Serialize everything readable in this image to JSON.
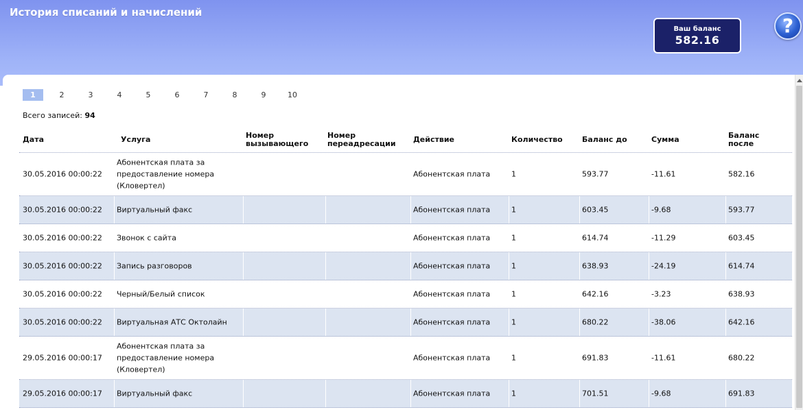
{
  "header": {
    "title": "История списаний и начислений",
    "balance_label": "Ваш баланс",
    "balance_value": "582.16",
    "help_icon": "?"
  },
  "pagination": {
    "pages": [
      "1",
      "2",
      "3",
      "4",
      "5",
      "6",
      "7",
      "8",
      "9",
      "10"
    ],
    "current": "1"
  },
  "summary": {
    "total_label": "Всего записей:",
    "total_count": "94"
  },
  "table": {
    "columns": {
      "date": "Дата",
      "service": "Услуга",
      "caller": "Номер вызывающего",
      "forward": "Номер переадресации",
      "action": "Действие",
      "qty": "Количество",
      "before": "Баланс до",
      "amount": "Сумма",
      "after": "Баланс после"
    },
    "rows": [
      {
        "date": "30.05.2016 00:00:22",
        "service": "Абонентская плата за предоставление номера (Кловертел)",
        "caller": "",
        "forward": "",
        "action": "Абонентская плата",
        "qty": "1",
        "before": "593.77",
        "amount": "-11.61",
        "after": "582.16"
      },
      {
        "date": "30.05.2016 00:00:22",
        "service": "Виртуальный факс",
        "caller": "",
        "forward": "",
        "action": "Абонентская плата",
        "qty": "1",
        "before": "603.45",
        "amount": "-9.68",
        "after": "593.77"
      },
      {
        "date": "30.05.2016 00:00:22",
        "service": "Звонок с сайта",
        "caller": "",
        "forward": "",
        "action": "Абонентская плата",
        "qty": "1",
        "before": "614.74",
        "amount": "-11.29",
        "after": "603.45"
      },
      {
        "date": "30.05.2016 00:00:22",
        "service": "Запись разговоров",
        "caller": "",
        "forward": "",
        "action": "Абонентская плата",
        "qty": "1",
        "before": "638.93",
        "amount": "-24.19",
        "after": "614.74"
      },
      {
        "date": "30.05.2016 00:00:22",
        "service": "Черный/Белый список",
        "caller": "",
        "forward": "",
        "action": "Абонентская плата",
        "qty": "1",
        "before": "642.16",
        "amount": "-3.23",
        "after": "638.93"
      },
      {
        "date": "30.05.2016 00:00:22",
        "service": "Виртуальная АТС Октолайн",
        "caller": "",
        "forward": "",
        "action": "Абонентская плата",
        "qty": "1",
        "before": "680.22",
        "amount": "-38.06",
        "after": "642.16"
      },
      {
        "date": "29.05.2016 00:00:17",
        "service": "Абонентская плата за предоставление номера (Кловертел)",
        "caller": "",
        "forward": "",
        "action": "Абонентская плата",
        "qty": "1",
        "before": "691.83",
        "amount": "-11.61",
        "after": "680.22"
      },
      {
        "date": "29.05.2016 00:00:17",
        "service": "Виртуальный факс",
        "caller": "",
        "forward": "",
        "action": "Абонентская плата",
        "qty": "1",
        "before": "701.51",
        "amount": "-9.68",
        "after": "691.83"
      }
    ]
  }
}
